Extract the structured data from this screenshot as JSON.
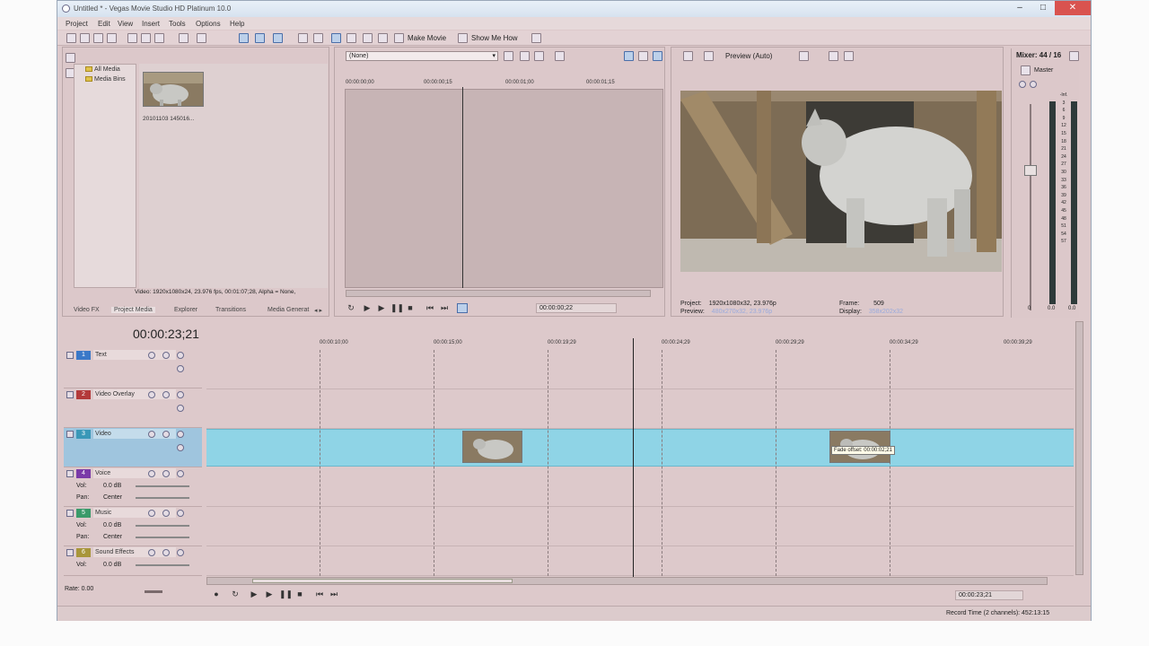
{
  "window": {
    "title": "Untitled * - Vegas Movie Studio HD Platinum 10.0",
    "minimize": "–",
    "maximize": "□",
    "close": "✕"
  },
  "menu": [
    "Project",
    "Edit",
    "View",
    "Insert",
    "Tools",
    "Options",
    "Help"
  ],
  "toolbar": {
    "make_movie": "Make Movie",
    "show_me_how": "Show Me How",
    "preview_mode": "Preview (Auto)"
  },
  "project_media": {
    "tree": [
      "All Media",
      "Media Bins"
    ],
    "file_name": "20101103 145016...",
    "info": "Video: 1920x1080x24, 23.976 fps, 00:01:07;28, Alpha = None,",
    "tabs": [
      "Video FX",
      "Project Media",
      "Explorer",
      "Transitions",
      "Media Generat"
    ]
  },
  "trimmer": {
    "dropdown": "(None)",
    "ruler": [
      "00:00:00;00",
      "00:00:00;15",
      "00:00:01;00",
      "00:00:01;15"
    ],
    "time": "00:00:00;22"
  },
  "preview": {
    "project_label": "Project:",
    "project_value": "1920x1080x32, 23.976p",
    "preview_label": "Preview:",
    "preview_value": "480x270x32, 23.976p",
    "frame_label": "Frame:",
    "frame_value": "509",
    "display_label": "Display:",
    "display_value": "358x202x32"
  },
  "mixer": {
    "title": "Mixer: 44 / 16",
    "master": "Master",
    "scale": [
      "-Inf.",
      "3",
      "6",
      "9",
      "12",
      "15",
      "18",
      "21",
      "24",
      "27",
      "30",
      "33",
      "36",
      "39",
      "42",
      "45",
      "48",
      "51",
      "54",
      "57"
    ],
    "left_db": "0.0",
    "right_db": "0.0",
    "fader_val": "0"
  },
  "timeline": {
    "current_time": "00:00:23;21",
    "ruler": [
      "00:00:10;00",
      "00:00:15;00",
      "00:00:19;29",
      "00:00:24;29",
      "00:00:29;29",
      "00:00:34;29",
      "00:00:39;29"
    ],
    "tracks": [
      {
        "num": "1",
        "name": "Text",
        "color": "#3a78c8"
      },
      {
        "num": "2",
        "name": "Video Overlay",
        "color": "#b33a3a"
      },
      {
        "num": "3",
        "name": "Video",
        "color": "#3a98b8"
      },
      {
        "num": "4",
        "name": "Voice",
        "color": "#7a3aa8"
      },
      {
        "num": "5",
        "name": "Music",
        "color": "#3a9a6a"
      },
      {
        "num": "6",
        "name": "Sound Effects",
        "color": "#a8963a"
      }
    ],
    "vol_label": "Vol:",
    "pan_label": "Pan:",
    "vol_value": "0.0 dB",
    "pan_value": "Center",
    "tooltip": "Fade offset: 00:00:02;21",
    "rate": "Rate: 0.00",
    "end_time": "00:00:23;21",
    "record_time": "Record Time (2 channels): 452:13:15"
  }
}
